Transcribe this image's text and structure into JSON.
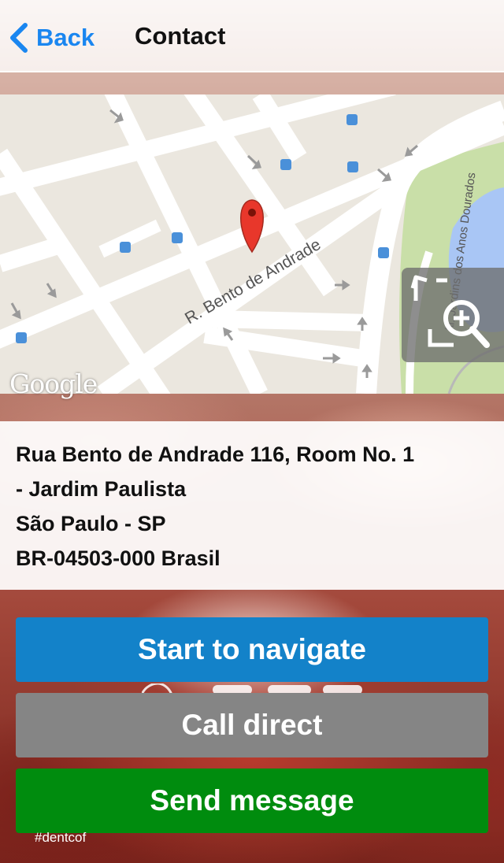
{
  "nav": {
    "back_label": "Back",
    "title": "Contact"
  },
  "map": {
    "street_label": "R. Bento de Andrade",
    "park_label": "Al. Jardins dos Anos Dourados",
    "attribution": "Google",
    "zoom_button_icon": "expand-zoom-icon",
    "marker_icon": "map-pin-icon"
  },
  "address": {
    "line1": "Rua Bento de Andrade 116, Room No. 1",
    "line2": "- Jardim Paulista",
    "line3": "São Paulo - SP",
    "line4": "BR-04503-000 Brasil"
  },
  "actions": {
    "navigate_label": "Start to navigate",
    "call_label": "Call direct",
    "message_label": "Send message"
  },
  "footer": {
    "hashtag": "#dentcof"
  },
  "colors": {
    "accent": "#1a86f0",
    "navigate": "#1382c9",
    "call": "#858585",
    "message": "#008c0e"
  }
}
